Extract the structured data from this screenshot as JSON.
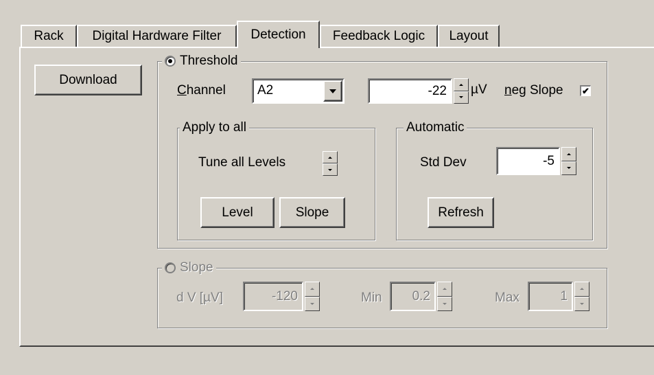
{
  "tabs": [
    {
      "label": "Rack",
      "active": false
    },
    {
      "label": "Digital Hardware Filter",
      "active": false
    },
    {
      "label": "Detection",
      "active": true
    },
    {
      "label": "Feedback Logic",
      "active": false
    },
    {
      "label": "Layout",
      "active": false
    }
  ],
  "download_label": "Download",
  "threshold": {
    "label": "Threshold",
    "selected": true,
    "channel_label_underlined": "C",
    "channel_label_rest": "hannel",
    "channel_value": "A2",
    "level_value": "-22",
    "unit": "µV",
    "neg_slope_underlined": "n",
    "neg_slope_rest": "eg Slope",
    "neg_slope_checked": true,
    "checkmark": "✔",
    "apply_to_all": {
      "label": "Apply to all",
      "tune_label": "Tune all Levels",
      "level_button": "Level",
      "slope_button": "Slope"
    },
    "automatic": {
      "label": "Automatic",
      "std_dev_label": "Std Dev",
      "std_dev_value": "-5",
      "refresh_button": "Refresh"
    }
  },
  "slope": {
    "label": "Slope",
    "selected": false,
    "dv_label": "d V [µV]",
    "dv_value": "-120",
    "min_label": "Min",
    "min_value": "0.2",
    "max_label": "Max",
    "max_value": "1"
  }
}
